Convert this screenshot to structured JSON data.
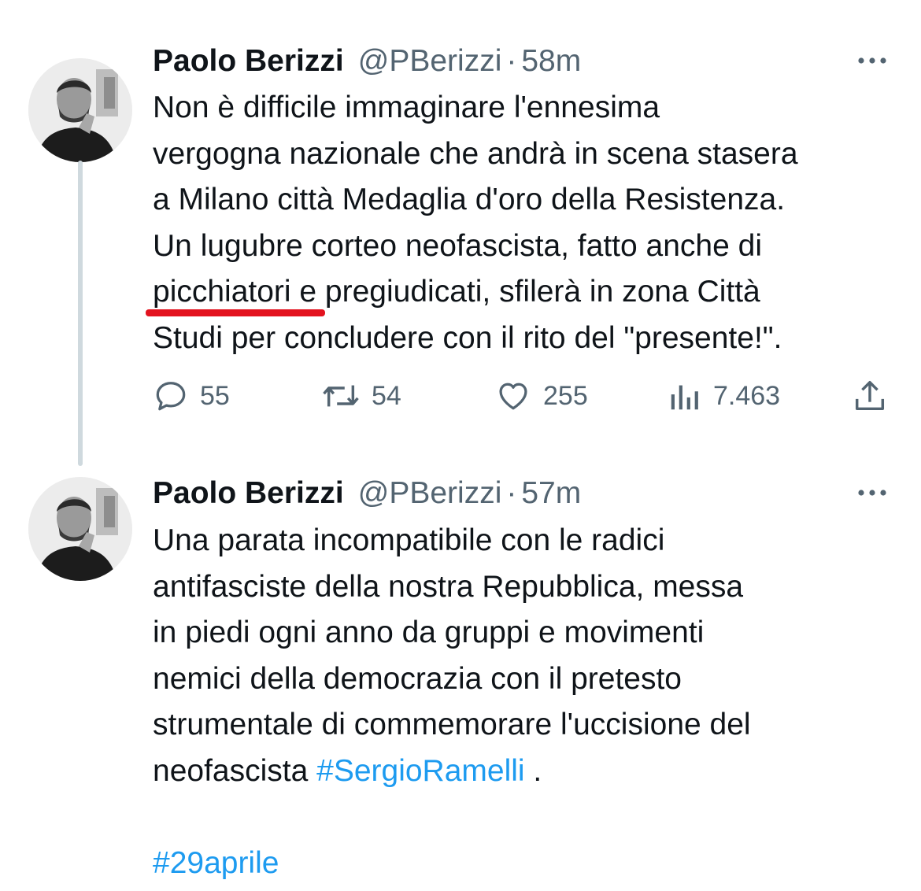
{
  "tweets": [
    {
      "author_name": "Paolo Berizzi",
      "handle": "@PBerizzi",
      "separator": "·",
      "time": "58m",
      "lines": [
        "Non è difficile immaginare l'ennesima",
        "vergogna nazionale che andrà in scena stasera",
        "a Milano città Medaglia d'oro della Resistenza.",
        "Un lugubre corteo neofascista, fatto anche di",
        "picchiatori e pregiudicati, sfilerà in zona Città",
        "Studi per concludere con il rito del \"presente!\"."
      ],
      "stats": {
        "replies": "55",
        "retweets": "54",
        "likes": "255",
        "views": "7.463"
      },
      "highlight_color": "#e3131f"
    },
    {
      "author_name": "Paolo Berizzi",
      "handle": "@PBerizzi",
      "separator": "·",
      "time": "57m",
      "lines": [
        "Una parata incompatibile con le radici",
        "antifasciste della nostra Repubblica, messa",
        "in piedi ogni anno da gruppi e movimenti",
        "nemici della democrazia con il pretesto",
        "strumentale di commemorare l'uccisione del"
      ],
      "last_line_prefix": "neofascista ",
      "hashtag_inline": "#SergioRamelli",
      "last_line_suffix": " .",
      "hashtag_final": "#29aprile"
    }
  ],
  "icons": {
    "more": "more-icon",
    "reply": "reply-icon",
    "retweet": "retweet-icon",
    "like": "heart-icon",
    "views": "views-icon",
    "share": "share-icon"
  },
  "colors": {
    "text": "#0f1419",
    "secondary": "#536471",
    "link": "#1d9bf0",
    "thread_line": "#cfd9de"
  }
}
